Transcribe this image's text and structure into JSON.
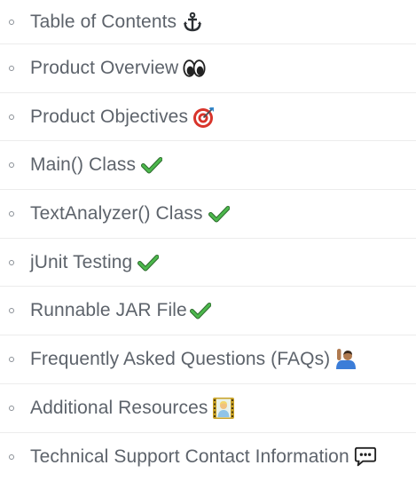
{
  "toc": {
    "items": [
      {
        "label": "Table of Contents",
        "icon": "anchor-icon"
      },
      {
        "label": "Product Overview",
        "icon": "eyes-icon"
      },
      {
        "label": "Product Objectives",
        "icon": "target-icon"
      },
      {
        "label": "Main() Class",
        "icon": "check-mark-icon"
      },
      {
        "label": "TextAnalyzer() Class",
        "icon": "check-mark-icon"
      },
      {
        "label": "jUnit Testing",
        "icon": "check-mark-icon"
      },
      {
        "label": "Runnable JAR File",
        "icon": "check-mark-icon"
      },
      {
        "label": "Frequently Asked Questions (FAQs)",
        "icon": "person-raising-hand-icon"
      },
      {
        "label": "Additional Resources",
        "icon": "film-frame-icon"
      },
      {
        "label": "Technical Support Contact Information",
        "icon": "speech-bubble-icon"
      }
    ]
  },
  "colors": {
    "text": "#5d636b",
    "divider": "#ececec",
    "check": "#3aa33a"
  }
}
